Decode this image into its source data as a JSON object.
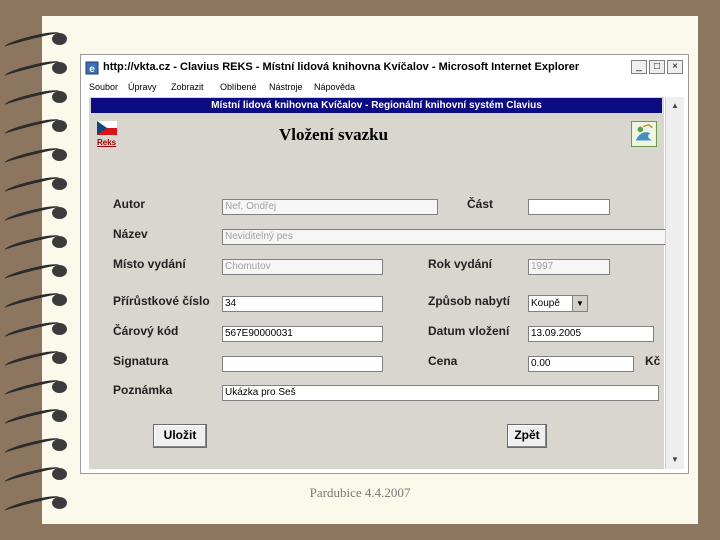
{
  "window": {
    "title": "http://vkta.cz - Clavius REKS - Místní lidová knihovna Kvíčalov - Microsoft Internet Explorer",
    "buttons": {
      "minimize": "_",
      "maximize": "□",
      "close": "×"
    }
  },
  "menu": [
    "Soubor",
    "Úpravy",
    "Zobrazit",
    "Oblíbené",
    "Nástroje",
    "Nápověda"
  ],
  "banner": "Místní lidová knihovna Kvíčalov - Regionální knihovní systém Clavius",
  "reks_link": "Reks",
  "form_title": "Vložení svazku",
  "fields": {
    "autor": {
      "label": "Autor",
      "value": "Nef, Ondřej"
    },
    "cast": {
      "label": "Část",
      "value": ""
    },
    "nazev": {
      "label": "Název",
      "value": "Neviditelný pes"
    },
    "misto": {
      "label": "Místo vydání",
      "value": "Chomutov"
    },
    "rok": {
      "label": "Rok vydání",
      "value": "1997"
    },
    "prirustkove": {
      "label": "Přírůstkové číslo",
      "value": "34"
    },
    "zpusob": {
      "label": "Způsob nabytí",
      "value": "Koupě"
    },
    "carovy": {
      "label": "Čárový kód",
      "value": "567E90000031"
    },
    "datum": {
      "label": "Datum vložení",
      "value": "13.09.2005"
    },
    "signatura": {
      "label": "Signatura",
      "value": ""
    },
    "cena": {
      "label": "Cena",
      "value": "0.00",
      "unit": "Kč"
    },
    "poznamka": {
      "label": "Poznámka",
      "value": "Ukázka pro Seš"
    }
  },
  "buttons": {
    "save": "Uložit",
    "back": "Zpět"
  },
  "footer": "Pardubice 4.4.2007"
}
